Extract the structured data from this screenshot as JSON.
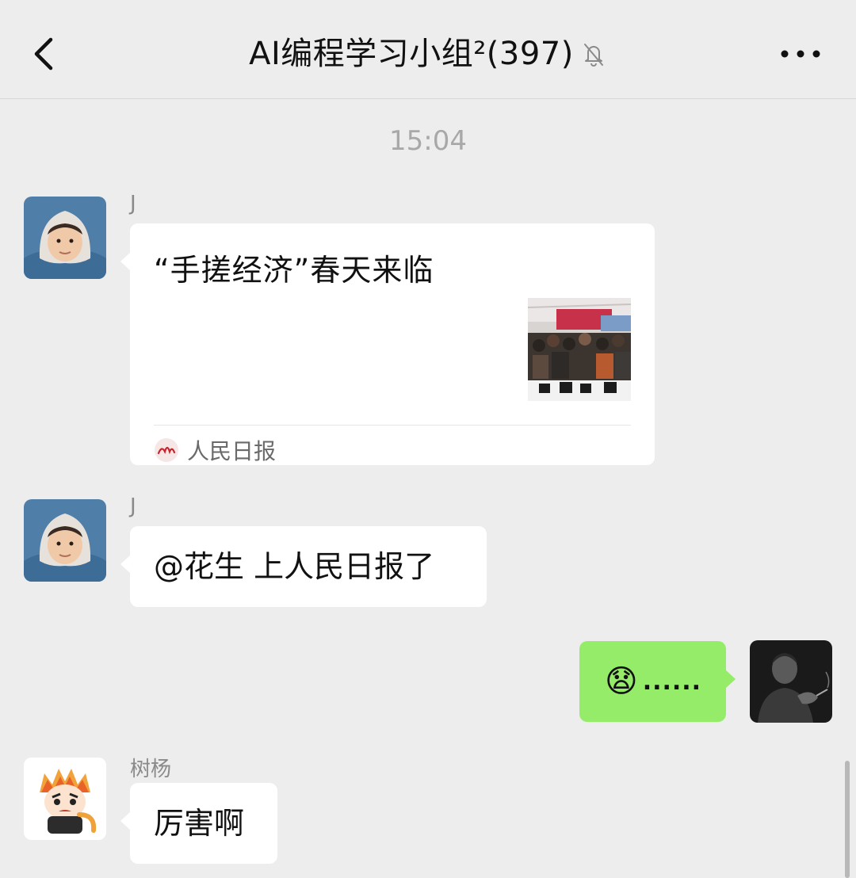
{
  "header": {
    "title": "AI编程学习小组²(397)",
    "back_icon": "chevron-left-icon",
    "mute_icon": "bell-slash-icon",
    "more_icon": "ellipsis-icon"
  },
  "timestamp": "15:04",
  "messages": [
    {
      "sender": "J",
      "type": "link",
      "title": "“手搓经济”春天来临",
      "source": "人民日报",
      "thumbnail": "news-photo"
    },
    {
      "sender": "J",
      "type": "text",
      "text": "@花生 上人民日报了"
    },
    {
      "sender": "",
      "type": "text",
      "self": true,
      "emoji": "😧",
      "text": "......"
    },
    {
      "sender": "树杨",
      "type": "text",
      "text": "厉害啊"
    }
  ],
  "colors": {
    "background": "#ededed",
    "bubble_other": "#ffffff",
    "bubble_self": "#95ec69",
    "sender_name": "#8a8a8a",
    "timestamp": "#a8a8a8"
  }
}
